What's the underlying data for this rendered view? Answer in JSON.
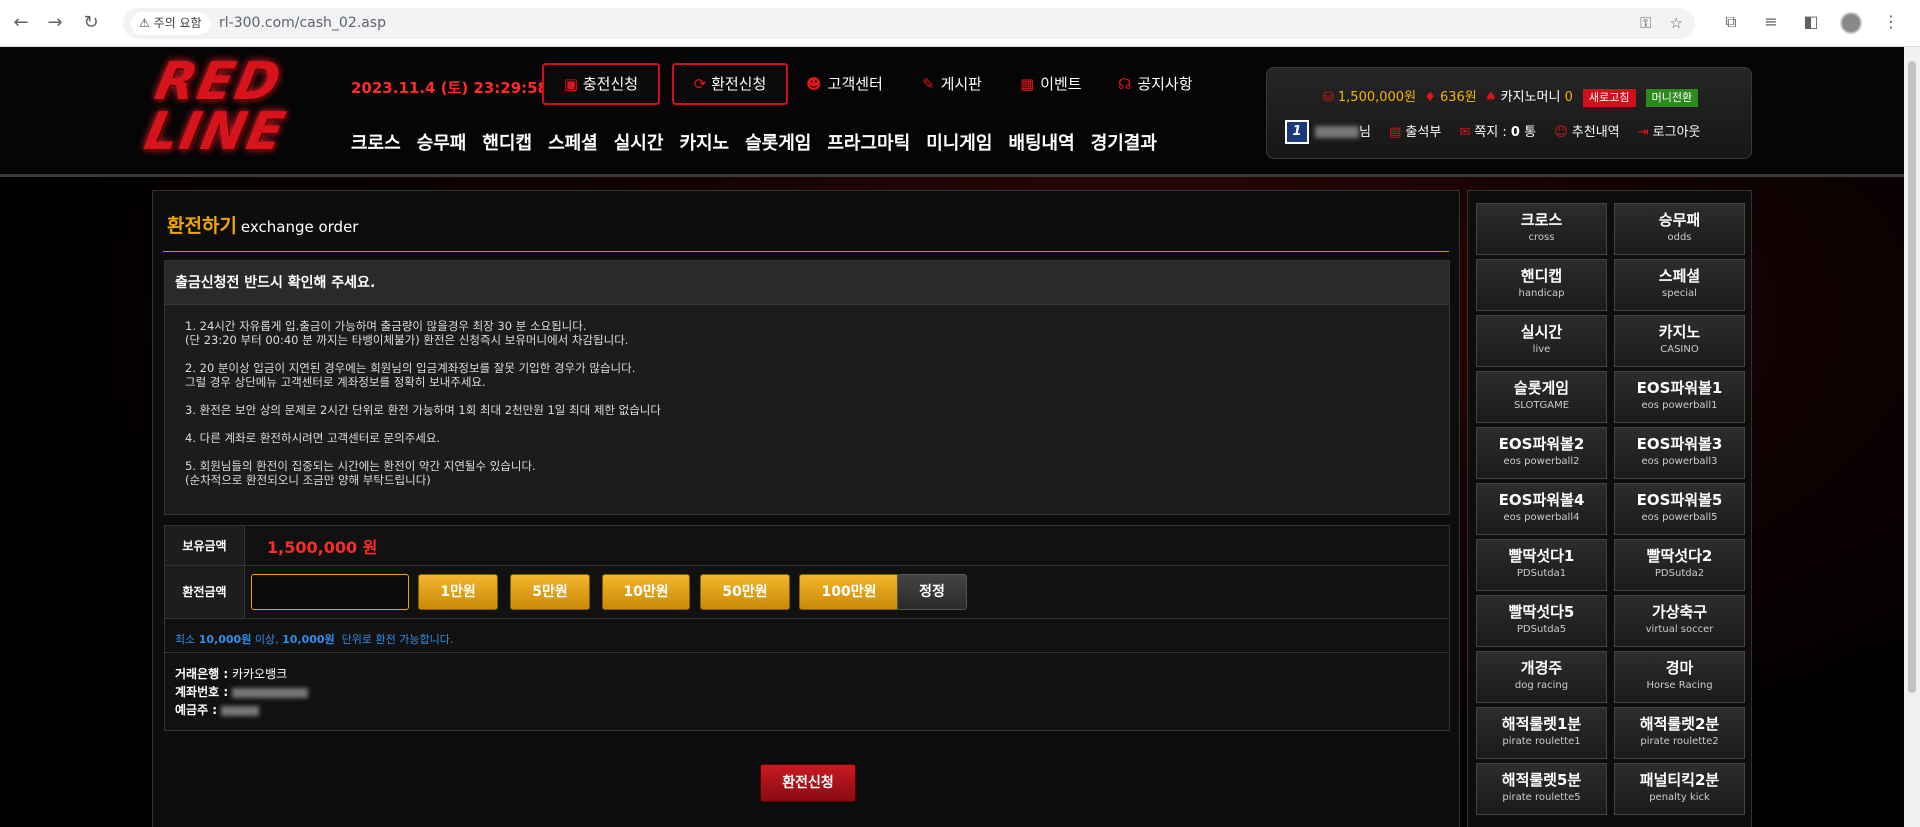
{
  "browser": {
    "warning": "주의 요함",
    "url": "rl-300.com/cash_02.asp"
  },
  "header": {
    "logo": "RED LINE",
    "datetime": "2023.11.4 (토) 23:29:58",
    "charge_btn": "충전신청",
    "exchange_btn": "환전신청",
    "links": [
      "고객센터",
      "게시판",
      "이벤트",
      "공지사항"
    ],
    "nav": [
      "크로스",
      "승무패",
      "핸디캡",
      "스페셜",
      "실시간",
      "카지노",
      "슬롯게임",
      "프라그마틱",
      "미니게임",
      "배팅내역",
      "경기결과"
    ]
  },
  "user": {
    "money": "1,500,000원",
    "points": "636원",
    "casino_label": "카지노머니",
    "casino_value": "0",
    "refresh": "새로고침",
    "money_convert": "머니전환",
    "level": "1",
    "name_suffix": "님",
    "attendance": "출석부",
    "memo_label": "쪽지 :",
    "memo_count": "0",
    "memo_unit": "통",
    "recommend": "추천내역",
    "logout": "로그아웃"
  },
  "content": {
    "title": "환전하기",
    "subtitle": "exchange order",
    "notice_head": "출금신청전 반드시 확인해 주세요.",
    "notices": [
      "1. 24시간 자유롭게 입.출금이 가능하며 출금량이 많을경우 최장 30 분 소요됩니다.\n(단 23:20 부터 00:40 분 까지는 타뱅이체불가) 환전은 신청즉시 보유머니에서 차감됩니다.",
      "2. 20 분이상 입금이 지연된 경우에는 회원님의 입금계좌정보를 잘못 기입한 경우가 많습니다.\n그럴 경우 상단메뉴 고객센터로 계좌정보를 정확히 보내주세요.",
      "3. 환전은 보안 상의 문제로 2시간 단위로 환전 가능하며 1회 최대 2천만원 1일 최대 제한 없습니다",
      "4. 다른 계좌로 환전하시려면 고객센터로 문의주세요.",
      "5. 회원님들의 환전이 집중되는 시간에는 환전이 약간 지연될수 있습니다.\n(순차적으로 환전되오니 조금만 양해 부탁드립니다)"
    ],
    "balance_label": "보유금액",
    "balance": "1,500,000 원",
    "amount_label": "환전금액",
    "amount_value": "",
    "amount_buttons": [
      "1만원",
      "5만원",
      "10만원",
      "50만원",
      "100만원"
    ],
    "reset": "정정",
    "hint_pre": "최소",
    "hint_min": "10,000원",
    "hint_mid": "이상,",
    "hint_unit": "10,000원",
    "hint_post": "단위로 환전 가능합니다.",
    "bank_label": "거래은행 :",
    "bank_value": "카카오뱅크",
    "account_label": "계좌번호 :",
    "owner_label": "예금주 :",
    "submit": "환전신청"
  },
  "side_menu": [
    {
      "ko": "크로스",
      "en": "cross"
    },
    {
      "ko": "승무패",
      "en": "odds"
    },
    {
      "ko": "핸디캡",
      "en": "handicap"
    },
    {
      "ko": "스페셜",
      "en": "special"
    },
    {
      "ko": "실시간",
      "en": "live"
    },
    {
      "ko": "카지노",
      "en": "CASINO"
    },
    {
      "ko": "슬롯게임",
      "en": "SLOTGAME"
    },
    {
      "ko": "EOS파워볼1",
      "en": "eos powerball1"
    },
    {
      "ko": "EOS파워볼2",
      "en": "eos powerball2"
    },
    {
      "ko": "EOS파워볼3",
      "en": "eos powerball3"
    },
    {
      "ko": "EOS파워볼4",
      "en": "eos powerball4"
    },
    {
      "ko": "EOS파워볼5",
      "en": "eos powerball5"
    },
    {
      "ko": "빨딱섯다1",
      "en": "PDSutda1"
    },
    {
      "ko": "빨딱섯다2",
      "en": "PDSutda2"
    },
    {
      "ko": "빨딱섯다5",
      "en": "PDSutda5"
    },
    {
      "ko": "가상축구",
      "en": "virtual soccer"
    },
    {
      "ko": "개경주",
      "en": "dog racing"
    },
    {
      "ko": "경마",
      "en": "Horse Racing"
    },
    {
      "ko": "해적룰렛1분",
      "en": "pirate roulette1"
    },
    {
      "ko": "해적룰렛2분",
      "en": "pirate roulette2"
    },
    {
      "ko": "해적룰렛5분",
      "en": "pirate roulette5"
    },
    {
      "ko": "패널티킥2분",
      "en": "penalty kick"
    }
  ]
}
